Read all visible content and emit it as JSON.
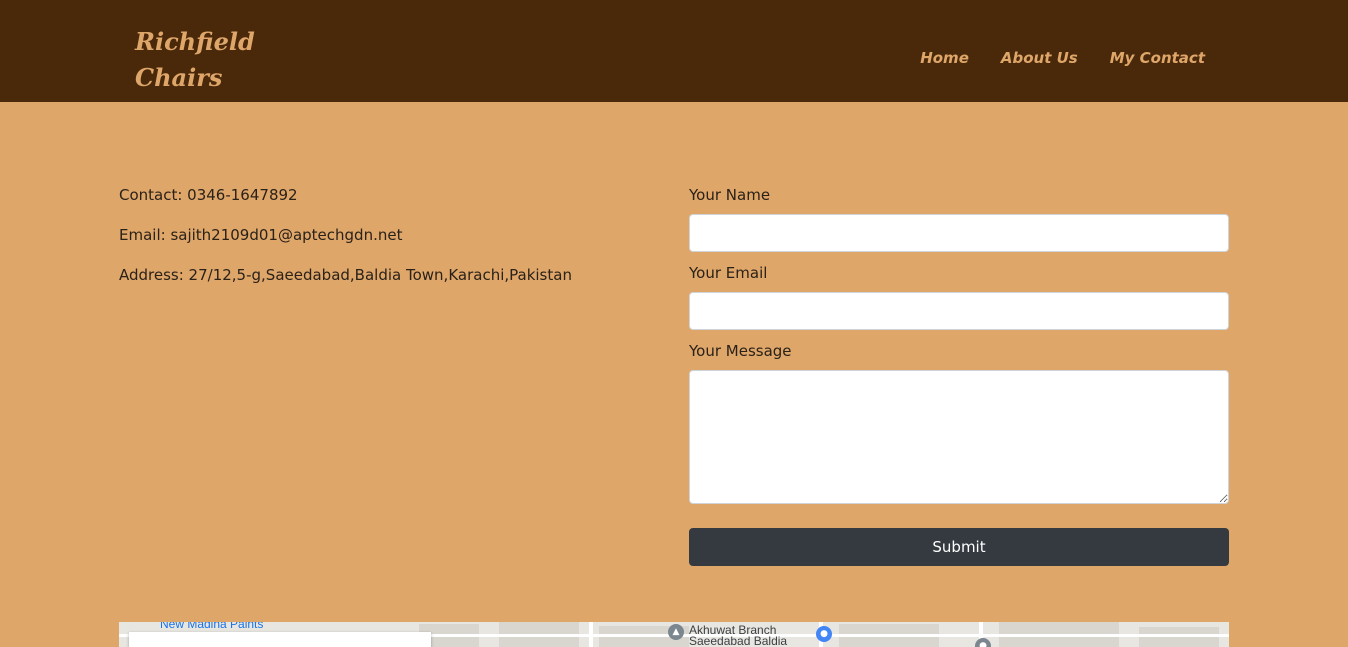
{
  "brand": {
    "line1": "Richfield",
    "line2": "Chairs"
  },
  "nav": {
    "home": "Home",
    "about": "About Us",
    "contact": "My Contact"
  },
  "info": {
    "contact": "Contact: 0346-1647892",
    "email": "Email: sajith2109d01@aptechgdn.net",
    "address": "Address: 27/12,5-g,Saeedabad,Baldia Town,Karachi,Pakistan"
  },
  "form": {
    "name_label": "Your Name",
    "name_value": "",
    "email_label": "Your Email",
    "email_value": "",
    "message_label": "Your Message",
    "message_value": "",
    "submit_label": "Submit"
  },
  "map": {
    "labels": {
      "paints": "New Madina Paints",
      "akhuwat": "Akhuwat Branch",
      "saeedabad": "Saeedabad Baldia"
    },
    "icons": [
      "school-pin-icon",
      "shopping-pin-icon",
      "place-pin-icon"
    ]
  },
  "colors": {
    "navbar": "#4a290b",
    "background": "#dfa66a",
    "accent_text": "#dfa66a",
    "button": "#343a40"
  }
}
